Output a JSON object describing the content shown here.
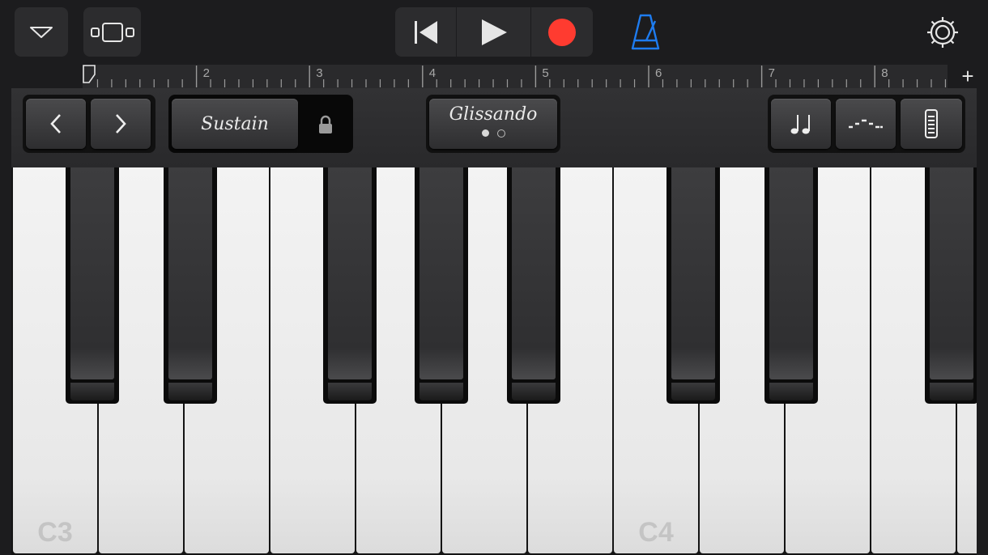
{
  "toolbar": {
    "dropdown_icon": "chevron-down-icon",
    "view_icon": "tracks-view-icon",
    "rewind_icon": "go-to-beginning-icon",
    "play_icon": "play-icon",
    "record_icon": "record-icon",
    "metronome_icon": "metronome-icon",
    "settings_icon": "gear-icon",
    "record_color": "#ff3b30",
    "metronome_color": "#1e7cf0"
  },
  "ruler": {
    "bars": [
      "2",
      "3",
      "4",
      "5",
      "6",
      "7",
      "8"
    ],
    "add_label": "+"
  },
  "controls": {
    "octave_down": "‹",
    "octave_up": "›",
    "sustain_label": "Sustain",
    "lock_icon": "lock-icon",
    "glissando_label": "Glissando",
    "glissando_page": 1,
    "glissando_pages": 2,
    "note_icon": "notes-icon",
    "arpeggiator_icon": "arpeggiator-icon",
    "keyboard_size_icon": "keyboard-size-icon"
  },
  "keyboard": {
    "labels": {
      "c3": "C3",
      "c4": "C4"
    }
  }
}
